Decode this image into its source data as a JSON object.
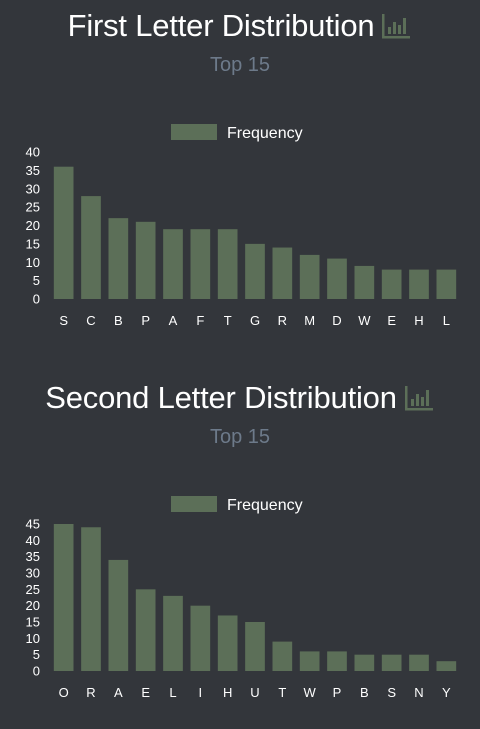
{
  "colors": {
    "background": "#33363b",
    "bar": "#5c6f58",
    "title": "#ffffff",
    "subtitle": "#6d7a8a",
    "axis_text": "#ffffff",
    "icon": "#5c6f58"
  },
  "icons": {
    "title_icon": "bar-chart-icon"
  },
  "sections": [
    {
      "title": "First Letter Distribution",
      "subtitle": "Top 15"
    },
    {
      "title": "Second Letter Distribution",
      "subtitle": "Top 15"
    }
  ],
  "chart_data": [
    {
      "type": "bar",
      "categories": [
        "S",
        "C",
        "B",
        "P",
        "A",
        "F",
        "T",
        "G",
        "R",
        "M",
        "D",
        "W",
        "E",
        "H",
        "L"
      ],
      "series": [
        {
          "name": "Frequency",
          "values": [
            36,
            28,
            22,
            21,
            19,
            19,
            19,
            15,
            14,
            12,
            11,
            9,
            8,
            8,
            8
          ]
        }
      ],
      "ylim": [
        0,
        40
      ],
      "yticks": [
        0,
        5,
        10,
        15,
        20,
        25,
        30,
        35,
        40
      ],
      "legend": "top-center",
      "grid": false
    },
    {
      "type": "bar",
      "categories": [
        "O",
        "R",
        "A",
        "E",
        "L",
        "I",
        "H",
        "U",
        "T",
        "W",
        "P",
        "B",
        "S",
        "N",
        "Y"
      ],
      "series": [
        {
          "name": "Frequency",
          "values": [
            45,
            44,
            34,
            25,
            23,
            20,
            17,
            15,
            9,
            6,
            6,
            5,
            5,
            5,
            3
          ]
        }
      ],
      "ylim": [
        0,
        45
      ],
      "yticks": [
        0,
        5,
        10,
        15,
        20,
        25,
        30,
        35,
        40,
        45
      ],
      "legend": "top-center",
      "grid": false
    }
  ]
}
